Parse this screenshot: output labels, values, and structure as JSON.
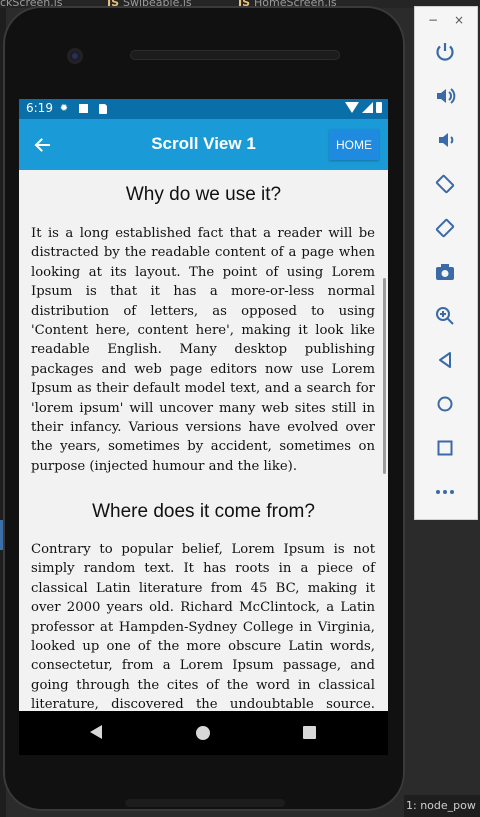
{
  "editor": {
    "tabs": [
      "ckScreen.js",
      "JS",
      "Swipeable.js",
      "JS",
      "HomeScreen.js"
    ],
    "status_right": "1: node_pow"
  },
  "statusbar": {
    "time": "6:19"
  },
  "appbar": {
    "title": "Scroll View 1",
    "home_label": "HOME",
    "back_icon": "arrow-left-icon"
  },
  "content": {
    "section1_title": "Why do we use it?",
    "section1_body": "It is a long established fact that a reader will be distracted by the readable content of a page when looking at its layout. The point of using Lorem Ipsum is that it has a more-or-less normal distribution of letters, as opposed to using 'Content here, content here', making it look like readable English. Many desktop publishing packages and web page editors now use Lorem Ipsum as their default model text, and a search for 'lorem ipsum' will uncover many web sites still in their infancy. Various versions have evolved over the years, sometimes by accident, sometimes on purpose (injected humour and the like).",
    "section2_title": "Where does it come from?",
    "section2_body": "Contrary to popular belief, Lorem Ipsum is not simply random text. It has roots in a piece of classical Latin literature from 45 BC, making it over 2000 years old. Richard McClintock, a Latin professor at Hampden-Sydney College in Virginia, looked up one of the more obscure Latin words, consectetur, from a Lorem Ipsum passage, and going through the cites of the word in classical literature, discovered the undoubtable source. Lorem Ipsum comes from"
  },
  "emulator": {
    "minimize": "−",
    "close": "×",
    "buttons": [
      "power-icon",
      "volume-up-icon",
      "volume-down-icon",
      "rotate-left-icon",
      "rotate-right-icon",
      "camera-icon",
      "zoom-icon",
      "back-icon",
      "home-icon",
      "overview-icon",
      "more-icon"
    ]
  },
  "colors": {
    "statusbar": "#0a6ea8",
    "appbar": "#1a9bd7",
    "home_button": "#1f8be0",
    "screen_bg": "#f2f2f2"
  }
}
